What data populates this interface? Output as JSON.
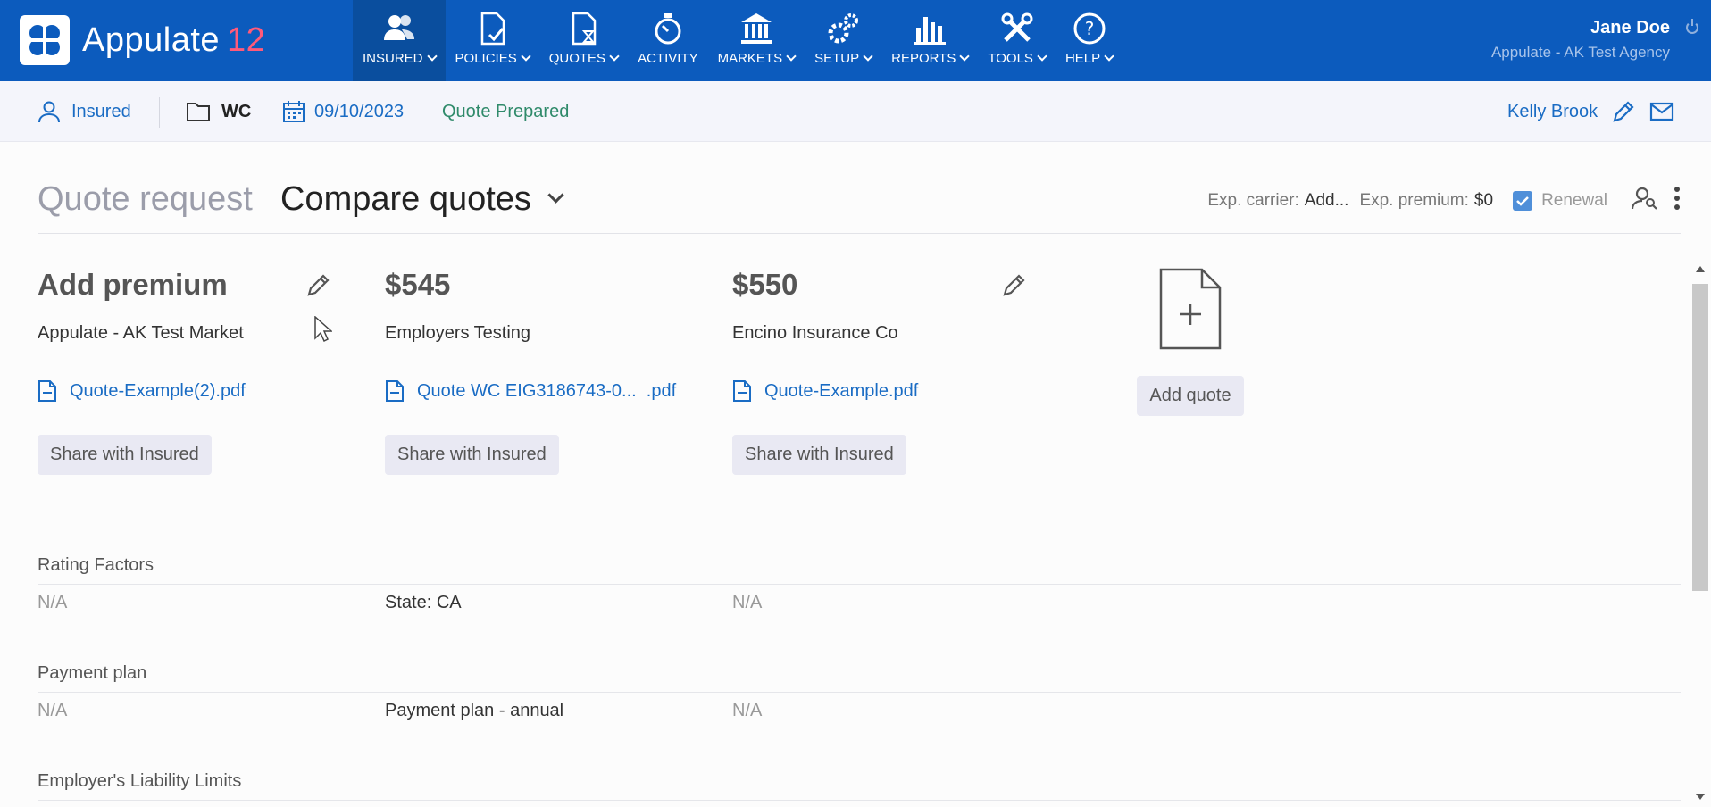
{
  "app": {
    "name": "Appulate",
    "version": "12"
  },
  "nav": [
    {
      "label": "INSURED",
      "icon": "insured-icon",
      "active": true
    },
    {
      "label": "POLICIES",
      "icon": "policies-icon"
    },
    {
      "label": "QUOTES",
      "icon": "quotes-icon"
    },
    {
      "label": "ACTIVITY",
      "icon": "activity-icon"
    },
    {
      "label": "MARKETS",
      "icon": "markets-icon"
    },
    {
      "label": "SETUP",
      "icon": "setup-icon"
    },
    {
      "label": "REPORTS",
      "icon": "reports-icon"
    },
    {
      "label": "TOOLS",
      "icon": "tools-icon"
    },
    {
      "label": "HELP",
      "icon": "help-icon"
    }
  ],
  "user": {
    "name": "Jane Doe",
    "agency": "Appulate - AK Test Agency"
  },
  "subbar": {
    "insured": "Insured",
    "lob": "WC",
    "date": "09/10/2023",
    "status": "Quote Prepared",
    "contact": "Kelly Brook"
  },
  "header": {
    "title_inactive": "Quote request",
    "title_active": "Compare quotes",
    "exp_carrier_label": "Exp. carrier:",
    "exp_carrier_value": "Add...",
    "exp_premium_label": "Exp. premium:",
    "exp_premium_value": "$0",
    "renewal_label": "Renewal"
  },
  "quotes": [
    {
      "premium": "Add premium",
      "carrier": "Appulate - AK Test Market",
      "file": "Quote-Example(2).pdf",
      "share": "Share with Insured"
    },
    {
      "premium": "$545",
      "carrier": "Employers Testing",
      "file": "Quote WC EIG3186743-0...  .pdf",
      "share": "Share with Insured"
    },
    {
      "premium": "$550",
      "carrier": "Encino Insurance Co",
      "file": "Quote-Example.pdf",
      "share": "Share with Insured"
    }
  ],
  "add_quote_label": "Add quote",
  "sections": [
    {
      "title": "Rating Factors",
      "values": [
        "N/A",
        "State: CA",
        "N/A"
      ]
    },
    {
      "title": "Payment plan",
      "values": [
        "N/A",
        "Payment plan - annual",
        "N/A"
      ]
    },
    {
      "title": "Employer's Liability Limits",
      "values": []
    }
  ],
  "colors": {
    "primary": "#0c5bbd",
    "link": "#1a6cc4",
    "status": "#2f8a6a",
    "version": "#ff5a7a"
  }
}
